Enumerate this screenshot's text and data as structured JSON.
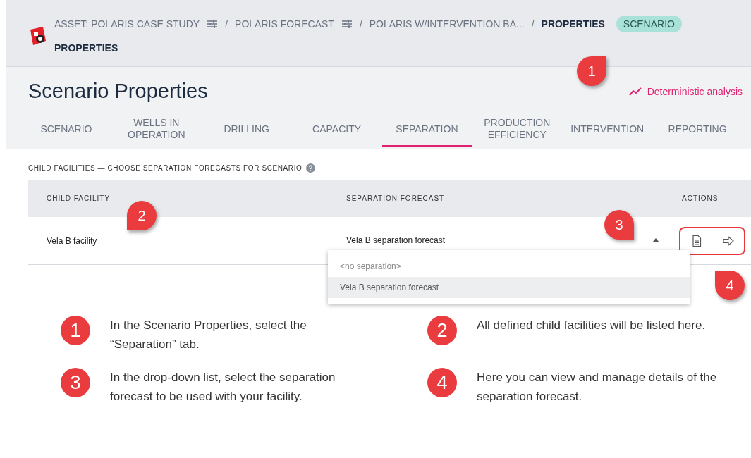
{
  "breadcrumb": {
    "items": [
      {
        "label": "ASSET: POLARIS CASE STUDY",
        "kind": "link",
        "settings": true
      },
      {
        "label": "POLARIS FORECAST",
        "kind": "link",
        "settings": true
      },
      {
        "label": "POLARIS W/INTERVENTION BA...",
        "kind": "link",
        "settings": false
      },
      {
        "label": "PROPERTIES",
        "kind": "current",
        "settings": false
      }
    ],
    "separator": "/",
    "badge": "SCENARIO",
    "second_line": "PROPERTIES"
  },
  "page_title": "Scenario Properties",
  "analysis_link": "Deterministic analysis",
  "tabs": [
    {
      "label": "SCENARIO",
      "selected": false
    },
    {
      "label": "WELLS IN OPERATION",
      "selected": false
    },
    {
      "label": "DRILLING",
      "selected": false
    },
    {
      "label": "CAPACITY",
      "selected": false
    },
    {
      "label": "SEPARATION",
      "selected": true
    },
    {
      "label": "PRODUCTION EFFICIENCY",
      "selected": false
    },
    {
      "label": "INTERVENTION",
      "selected": false
    },
    {
      "label": "REPORTING",
      "selected": false
    }
  ],
  "section_label": "CHILD FACILITIES — CHOOSE SEPARATION FORECASTS FOR SCENARIO",
  "table": {
    "columns": [
      "CHILD FACILITY",
      "SEPARATION FORECAST",
      "ACTIONS"
    ],
    "rows": [
      {
        "facility": "Vela B facility",
        "forecast": "Vela B separation forecast"
      }
    ]
  },
  "dropdown": {
    "expanded": true,
    "options": [
      {
        "label": "<no separation>",
        "selected": false
      },
      {
        "label": "Vela B separation forecast",
        "selected": true
      }
    ]
  },
  "callouts": [
    {
      "number": "1"
    },
    {
      "number": "2"
    },
    {
      "number": "3"
    },
    {
      "number": "4"
    }
  ],
  "instructions": [
    {
      "number": "1",
      "text": "In the Scenario Properties, select the “Separation” tab."
    },
    {
      "number": "2",
      "text": "All defined child facilities will be listed here."
    },
    {
      "number": "3",
      "text": "In the drop-down list, select the separation forecast to be used with your facility."
    },
    {
      "number": "4",
      "text": "Here you can view and manage details of the separation forecast."
    }
  ]
}
